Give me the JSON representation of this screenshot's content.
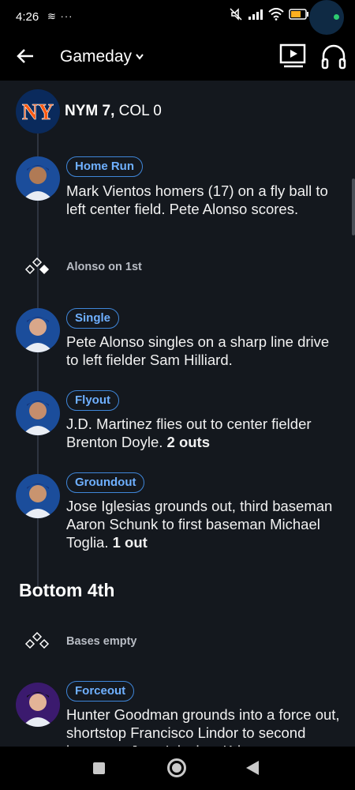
{
  "status_bar": {
    "time": "4:26",
    "left_icons": "≋ ···",
    "right_icons": [
      "mute-icon",
      "signal-icon",
      "wifi-icon",
      "battery-icon"
    ]
  },
  "app_bar": {
    "title": "Gameday",
    "title_chevron": "⌄"
  },
  "score": {
    "team_abbr": "NYM 7,",
    "opponent": "COL 0",
    "logo_text": "NY"
  },
  "plays": [
    {
      "badge": "Home Run",
      "description": "Mark Vientos homers (17) on a fly ball to left center field. Pete Alonso scores.",
      "bold_suffix": ""
    },
    {
      "badge": "Single",
      "description": "Pete Alonso singles on a sharp line drive to left fielder Sam Hilliard.",
      "bold_suffix": ""
    },
    {
      "badge": "Flyout",
      "description": "J.D. Martinez flies out to center fielder Brenton Doyle.",
      "bold_suffix": "2 outs"
    },
    {
      "badge": "Groundout",
      "description": "Jose Iglesias grounds out, third baseman Aaron Schunk to first baseman Michael Toglia.",
      "bold_suffix": "1 out"
    },
    {
      "badge": "Forceout",
      "description": "Hunter Goodman grounds into a force out, shortstop Francisco Lindor to second baseman Jose Iglesias. Kris",
      "bold_suffix": ""
    }
  ],
  "bases": [
    {
      "label": "Alonso on 1st"
    },
    {
      "label": "Bases empty"
    }
  ],
  "inning_header": "Bottom 4th",
  "colors": {
    "feed_bg": "#14181e",
    "badge_border": "#3f86d9",
    "badge_text": "#6fb0ff",
    "mets_blue": "#0a2a5c",
    "mets_orange": "#ff5910",
    "rockies_purple": "#3b1a6e"
  }
}
